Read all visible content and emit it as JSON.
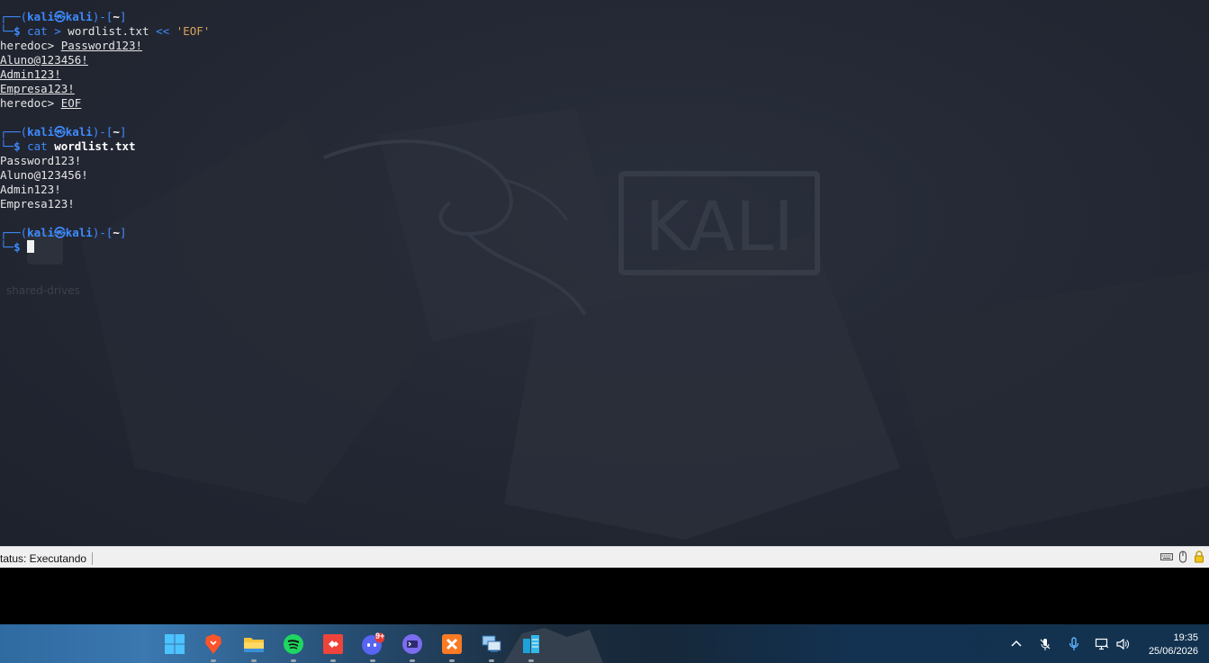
{
  "terminal": {
    "user": "kali",
    "host": "kali",
    "cwd": "~",
    "block1": {
      "cmd": "cat",
      "redirect": ">",
      "file": "wordlist.txt",
      "heredoc_op": "<<",
      "delim": "'EOF'",
      "heredoc_prompt": "heredoc> ",
      "inputs": [
        "Password123!",
        "Aluno@123456!",
        "Admin123!",
        "Empresa123!"
      ],
      "end": "EOF"
    },
    "block2": {
      "cmd": "cat",
      "file": "wordlist.txt",
      "output": [
        "Password123!",
        "Aluno@123456!",
        "Admin123!",
        "Empresa123!"
      ]
    }
  },
  "desktop": {
    "wallpaper_text": "KALI",
    "icon_label": "shared-drives"
  },
  "statusbar": {
    "text": "tatus: Executando",
    "icons": [
      "keyboard-icon",
      "mouse-icon",
      "lock-icon"
    ]
  },
  "taskbar": {
    "apps": [
      "windows-start-icon",
      "brave-icon",
      "file-explorer-icon",
      "spotify-icon",
      "anydesk-icon",
      "discord-icon",
      "terminal-icon",
      "xampp-icon",
      "remote-desktop-icon",
      "database-icon"
    ],
    "discord_badge": "9+",
    "clock_time": "19:35",
    "clock_date": "25/06/2026"
  },
  "colors": {
    "prompt_blue": "#3e8bff",
    "string_orange": "#d7a35a",
    "desktop_bg": "#232733"
  }
}
